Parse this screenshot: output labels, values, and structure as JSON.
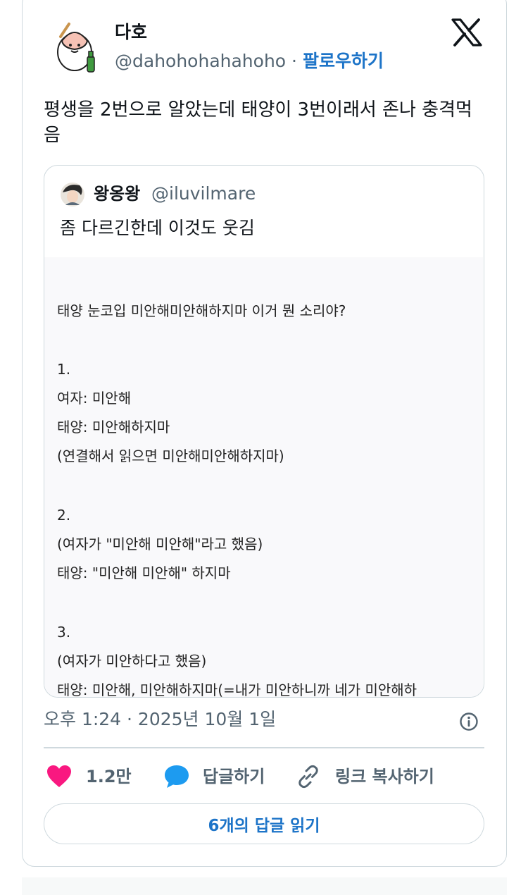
{
  "author": {
    "name": "다호",
    "handle": "@dahohohahahoho",
    "separator": "·",
    "follow_label": "팔로우하기"
  },
  "tweet_text": "평생을 2번으로 알았는데 태양이 3번이래서 존나 충격먹음",
  "tweet_text_lines": [
    "평생을 2번으로 알았는데 태양이 3번이래서 존나 충격먹",
    "음"
  ],
  "quoted": {
    "name": "왕옹왕",
    "handle": "@iluvilmare",
    "text": "좀 다르긴한데 이것도 웃김",
    "image_lines": [
      "태양 눈코입 미안해미안해하지마 이거 뭔 소리야?",
      "",
      "1.",
      "여자: 미안해",
      "태양: 미안해하지마",
      "(연결해서 읽으면 미안해미안해하지마)",
      "",
      "2.",
      "(여자가 \"미안해 미안해\"라고 했음)",
      "태양: \"미안해 미안해\" 하지마",
      "",
      "3.",
      "(여자가 미안하다고 했음)",
      "태양: 미안해, 미안해하지마(=내가 미안하니까 네가 미안해하"
    ]
  },
  "timestamp": "오후 1:24 · 2025년 10월 1일",
  "actions": {
    "like_count": "1.2만",
    "reply_label": "답글하기",
    "copy_label": "링크 복사하기"
  },
  "replies_button": "6개의 답글 읽기",
  "colors": {
    "accent": "#1d74c8",
    "like": "#f91880",
    "reply": "#1d9bf0",
    "muted": "#536471",
    "border": "#cfd9de"
  },
  "icons": [
    "x-logo-icon",
    "info-icon",
    "heart-icon",
    "speech-bubble-icon",
    "link-icon"
  ]
}
